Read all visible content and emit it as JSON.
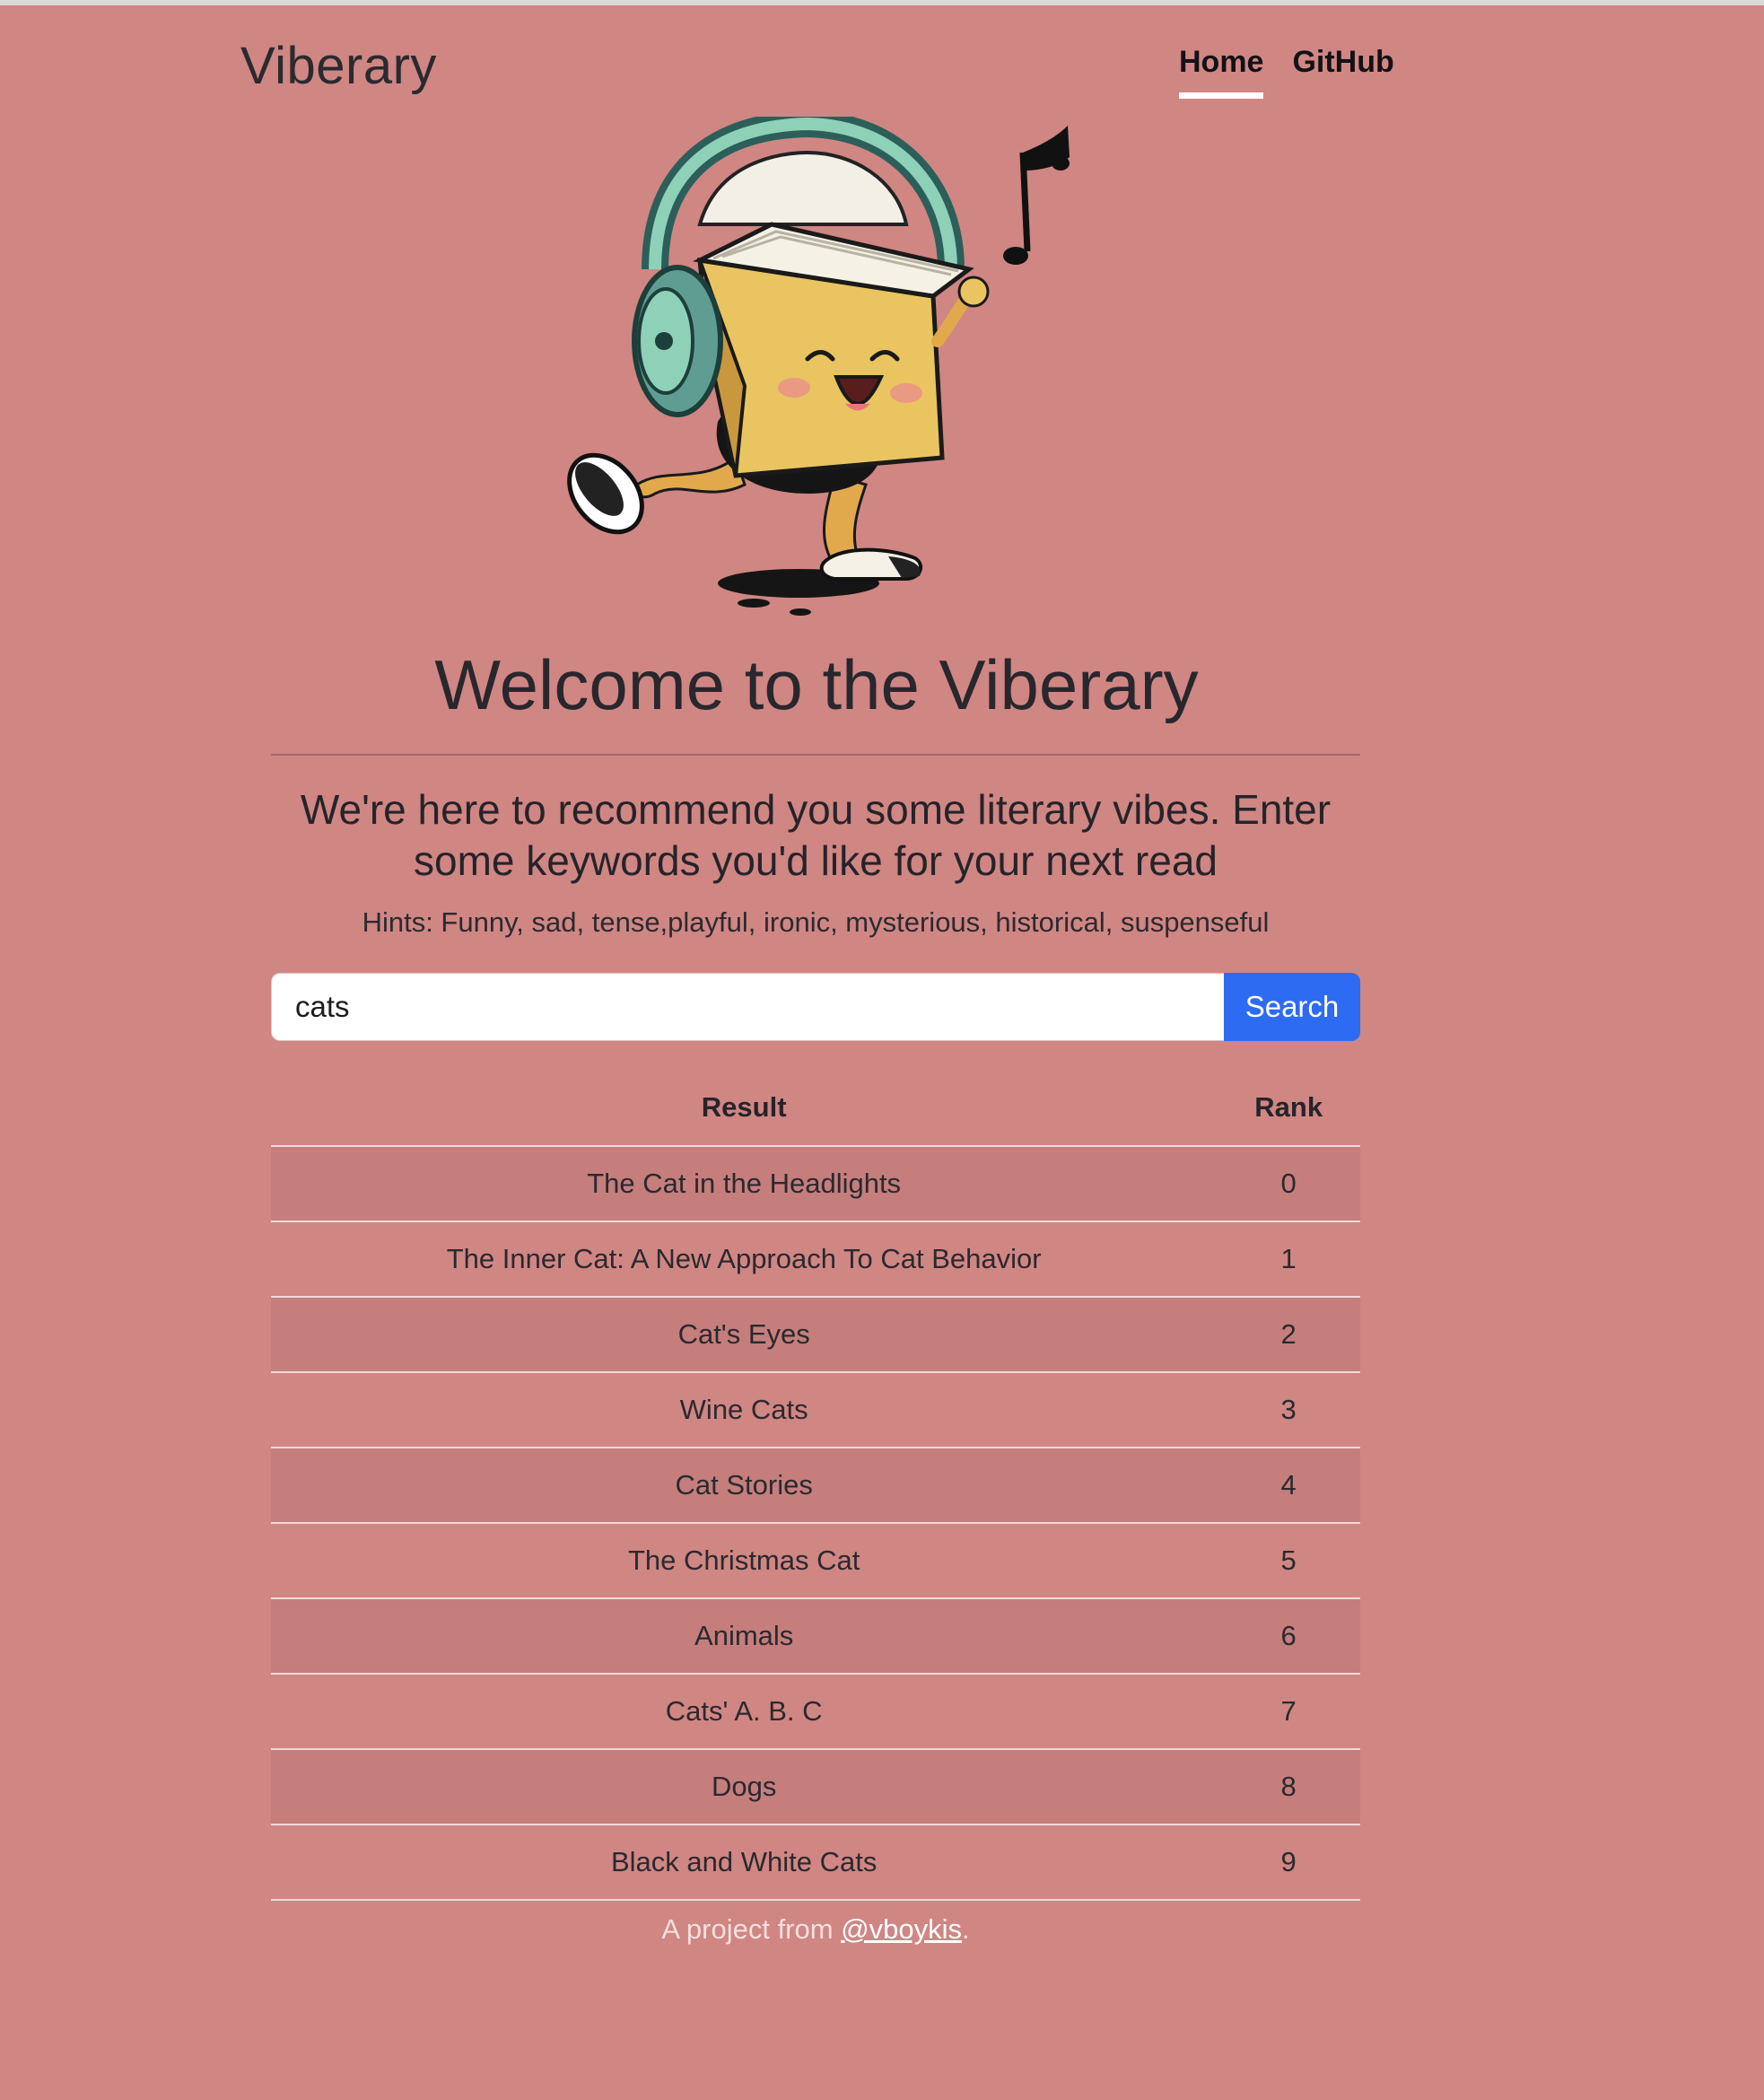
{
  "header": {
    "brand": "Viberary",
    "nav": [
      {
        "label": "Home",
        "active": true
      },
      {
        "label": "GitHub",
        "active": false
      }
    ]
  },
  "hero": {
    "title": "Welcome to the Viberary",
    "lead": "We're here to recommend you some literary vibes. Enter some keywords you'd like for your next read",
    "hints": "Hints: Funny, sad, tense,playful, ironic, mysterious, historical, suspenseful"
  },
  "search": {
    "value": "cats",
    "button_label": "Search"
  },
  "results": {
    "headers": [
      "Result",
      "Rank"
    ],
    "rows": [
      {
        "title": "The Cat in the Headlights",
        "rank": "0"
      },
      {
        "title": "The Inner Cat: A New Approach To Cat Behavior",
        "rank": "1"
      },
      {
        "title": "Cat's Eyes",
        "rank": "2"
      },
      {
        "title": "Wine Cats",
        "rank": "3"
      },
      {
        "title": "Cat Stories",
        "rank": "4"
      },
      {
        "title": "The Christmas Cat",
        "rank": "5"
      },
      {
        "title": "Animals",
        "rank": "6"
      },
      {
        "title": "Cats' A. B. C",
        "rank": "7"
      },
      {
        "title": "Dogs",
        "rank": "8"
      },
      {
        "title": "Black and White Cats",
        "rank": "9"
      }
    ]
  },
  "footer": {
    "prefix": "A project from ",
    "link": "@vboykis",
    "suffix": "."
  },
  "colors": {
    "background": "#d08683",
    "stripe": "#c57e7c",
    "accent": "#2d6bf3",
    "text": "#24232a"
  },
  "icons": {
    "mascot": "dancing-book-with-headphones",
    "note": "music-note-icon"
  }
}
